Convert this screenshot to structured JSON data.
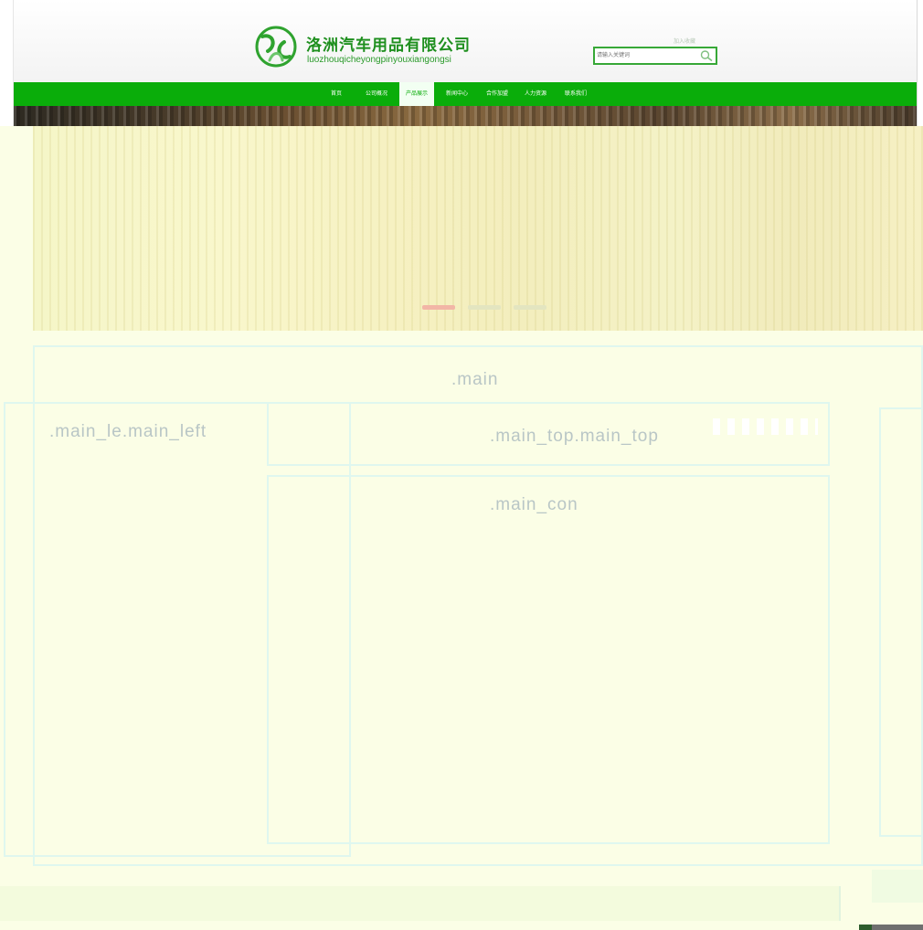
{
  "header": {
    "company_name": "洛洲汽车用品有限公司",
    "company_pinyin": "luozhouqicheyongpinyouxiangongsi",
    "favorite_text": "加入收藏",
    "search": {
      "placeholder": "请输入关键词"
    }
  },
  "nav": {
    "items": [
      {
        "label": "首页",
        "active": false
      },
      {
        "label": "公司概况",
        "active": false
      },
      {
        "label": "产品展示",
        "active": true
      },
      {
        "label": "新闻中心",
        "active": false
      },
      {
        "label": "合作加盟",
        "active": false
      },
      {
        "label": "人力资源",
        "active": false
      },
      {
        "label": "联系我们",
        "active": false
      }
    ]
  },
  "banner": {
    "slides": [
      {
        "active": true
      },
      {
        "active": false
      },
      {
        "active": false
      }
    ]
  },
  "overlay": {
    "main_label": ".main",
    "main_left_label": ".main_le.main_left",
    "main_top_label": ".main_top.main_top",
    "main_con_label": ".main_con"
  },
  "colors": {
    "brand_green": "#0aad0a",
    "overlay_tint": "#fbfee6",
    "outline": "#dff7ef"
  }
}
